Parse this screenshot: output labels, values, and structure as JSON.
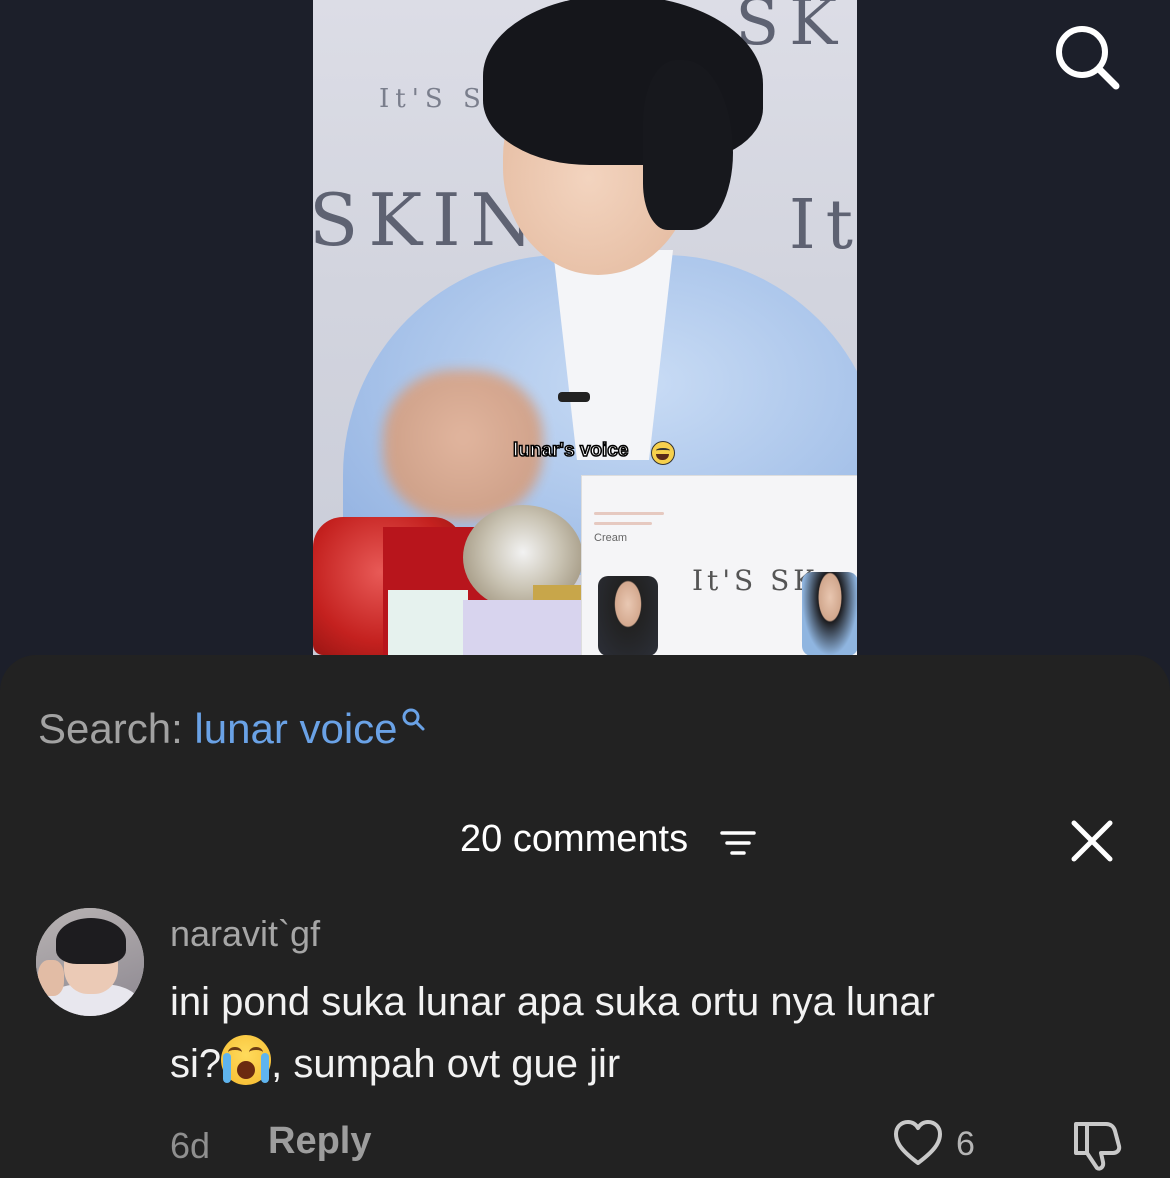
{
  "video": {
    "caption": "lunar's voice",
    "caption_emoji": "grinning-squinting-emoji",
    "background_text": [
      "SK",
      "It'S S",
      "SKIN",
      "It"
    ],
    "product_text": [
      "Cream",
      "It'S SK"
    ]
  },
  "header": {
    "search_icon": "search-icon"
  },
  "sheet": {
    "search_prefix": "Search:",
    "search_term": "lunar voice",
    "comments_count": "20 comments",
    "sort_icon": "sort-icon",
    "close_icon": "close-icon"
  },
  "comments": [
    {
      "username": "naravit`gf",
      "text_line1": "ini pond suka lunar apa suka ortu nya lunar",
      "text_line2_before": "si?",
      "text_emoji": "loudly-crying-face-emoji",
      "text_line2_after": ", sumpah ovt gue jir",
      "time": "6d",
      "reply_label": "Reply",
      "like_count": "6"
    }
  ],
  "colors": {
    "background": "#1c1f2a",
    "sheet": "#222222",
    "search_term": "#6aa2e6",
    "muted": "#a6a6a6"
  }
}
